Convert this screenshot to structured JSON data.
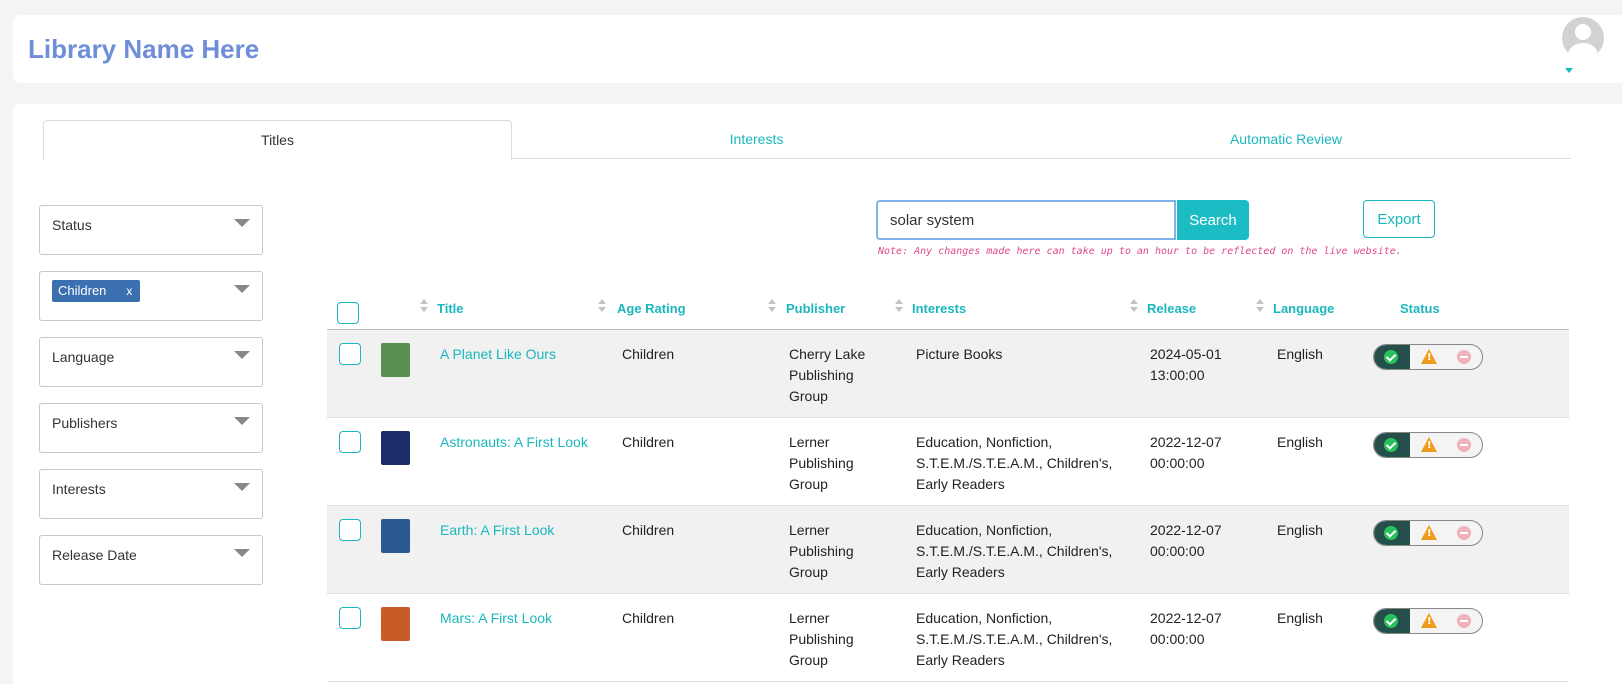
{
  "header": {
    "library_name": "Library Name Here"
  },
  "tabs": [
    "Titles",
    "Interests",
    "Automatic Review"
  ],
  "filters": {
    "status": "Status",
    "selected_chip": "Children",
    "chip_remove": "x",
    "language": "Language",
    "publishers": "Publishers",
    "interests": "Interests",
    "release_date": "Release Date"
  },
  "search": {
    "value": "solar system",
    "button": "Search",
    "export": "Export"
  },
  "note": "Note: Any changes made here can take up to an hour to be reflected on the live website.",
  "table": {
    "columns": {
      "title": "Title",
      "age_rating": "Age Rating",
      "publisher": "Publisher",
      "interests": "Interests",
      "release": "Release",
      "language": "Language",
      "status": "Status"
    },
    "rows": [
      {
        "title": "A Planet Like Ours",
        "age": "Children",
        "publisher": "Cherry Lake Publishing Group",
        "interests": "Picture Books",
        "release": "2024-05-01 13:00:00",
        "language": "English",
        "cover_color": "#5a8f52"
      },
      {
        "title": "Astronauts: A First Look",
        "age": "Children",
        "publisher": "Lerner Publishing Group",
        "interests": "Education, Nonfiction, S.T.E.M./S.T.E.A.M., Children's, Early Readers",
        "release": "2022-12-07 00:00:00",
        "language": "English",
        "cover_color": "#1b2d6a"
      },
      {
        "title": "Earth: A First Look",
        "age": "Children",
        "publisher": "Lerner Publishing Group",
        "interests": "Education, Nonfiction, S.T.E.M./S.T.E.A.M., Children's, Early Readers",
        "release": "2022-12-07 00:00:00",
        "language": "English",
        "cover_color": "#2b5a93"
      },
      {
        "title": "Mars: A First Look",
        "age": "Children",
        "publisher": "Lerner Publishing Group",
        "interests": "Education, Nonfiction, S.T.E.M./S.T.E.A.M., Children's, Early Readers",
        "release": "2022-12-07 00:00:00",
        "language": "English",
        "cover_color": "#c85a28"
      }
    ]
  },
  "colors": {
    "accent": "#1bb7be",
    "brand_title": "#6f8ed8",
    "chip": "#3a6fb0",
    "note": "#e0478c"
  }
}
